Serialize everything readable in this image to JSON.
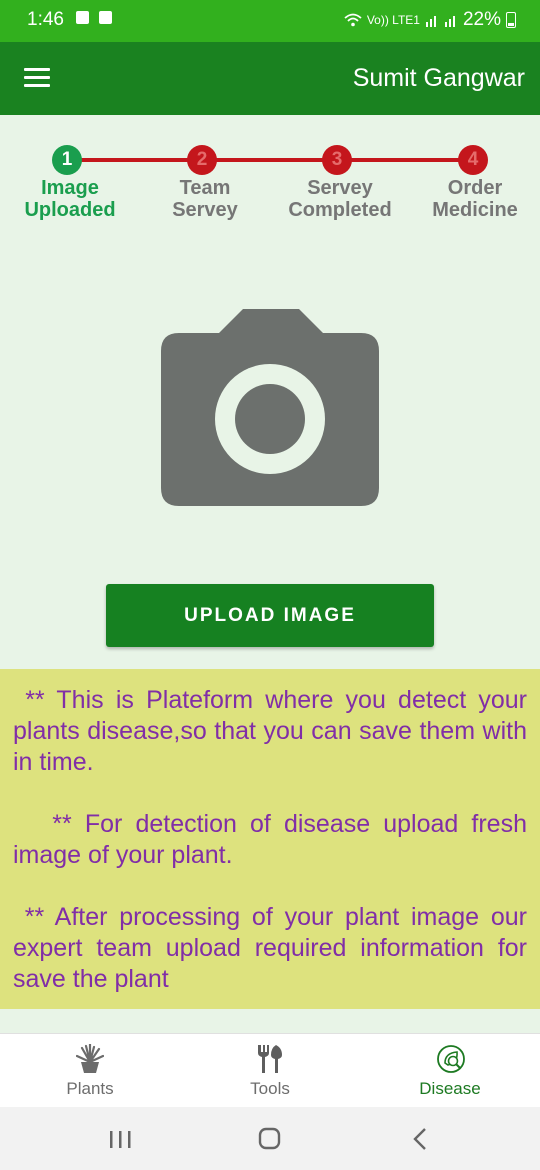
{
  "status_bar": {
    "time": "1:46",
    "network_label": "Vo)) LTE1",
    "battery": "22%"
  },
  "app_bar": {
    "title": "Sumit Gangwar",
    "menu_icon": "hamburger-menu-icon"
  },
  "stepper": {
    "steps": [
      {
        "number": "1",
        "line1": "Image",
        "line2": "Uploaded",
        "active": true
      },
      {
        "number": "2",
        "line1": "Team",
        "line2": "Servey",
        "active": false
      },
      {
        "number": "3",
        "line1": "Servey",
        "line2": "Completed",
        "active": false
      },
      {
        "number": "4",
        "line1": "Order",
        "line2": "Medicine",
        "active": false
      }
    ],
    "active_color": "#1a9e4e",
    "inactive_color": "#c4161c"
  },
  "upload": {
    "icon": "camera-icon",
    "button_label": "UPLOAD IMAGE"
  },
  "info": {
    "paragraphs": [
      " ** This is Plateform where you detect your plants disease,so that you can save them with in time.",
      "   ** For detection of disease upload fresh image of your plant.",
      " ** After processing of your plant image our expert team upload required information for save the plant"
    ]
  },
  "bottom_nav": {
    "items": [
      {
        "label": "Plants",
        "icon": "plant-icon"
      },
      {
        "label": "Tools",
        "icon": "tools-icon"
      },
      {
        "label": "Disease",
        "icon": "disease-icon",
        "active": true
      }
    ]
  },
  "colors": {
    "status_bar": "#32b01e",
    "app_bar": "#1a8220",
    "background": "#e8f4e7",
    "info_bg": "#dde27e",
    "info_text": "#812ea7",
    "button": "#168121"
  }
}
